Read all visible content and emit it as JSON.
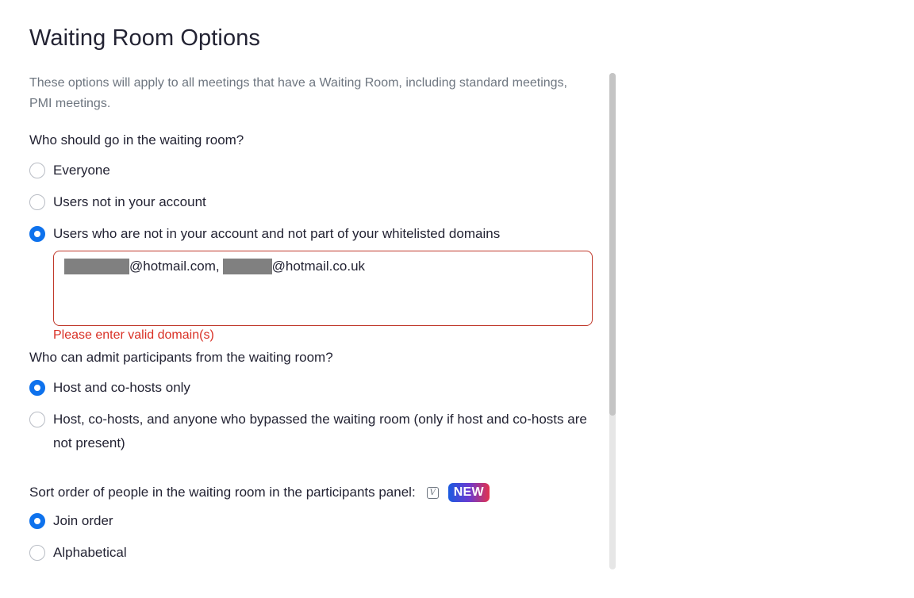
{
  "title": "Waiting Room Options",
  "description": "These options will apply to all meetings that have a Waiting Room, including standard meetings, PMI meetings.",
  "who_waits": {
    "question": "Who should go in the waiting room?",
    "options": [
      {
        "label": "Everyone",
        "checked": false
      },
      {
        "label": "Users not in your account",
        "checked": false
      },
      {
        "label": "Users who are not in your account and not part of your whitelisted domains",
        "checked": true
      }
    ],
    "domains_value_part1": "@hotmail.com,",
    "domains_value_part2": "@hotmail.co.uk",
    "error": "Please enter valid domain(s)"
  },
  "who_admits": {
    "question": "Who can admit participants from the waiting room?",
    "options": [
      {
        "label": "Host and co-hosts only",
        "checked": true
      },
      {
        "label": "Host, co-hosts, and anyone who bypassed the waiting room (only if host and co-hosts are not present)",
        "checked": false
      }
    ]
  },
  "sort_order": {
    "label": "Sort order of people in the waiting room in the participants panel:",
    "info_icon": "v-info-icon",
    "badge": "NEW",
    "options": [
      {
        "label": "Join order",
        "checked": true
      },
      {
        "label": "Alphabetical",
        "checked": false
      }
    ]
  },
  "colors": {
    "accent": "#0e72ed",
    "error": "#d93025",
    "muted_text": "#6e7680"
  }
}
